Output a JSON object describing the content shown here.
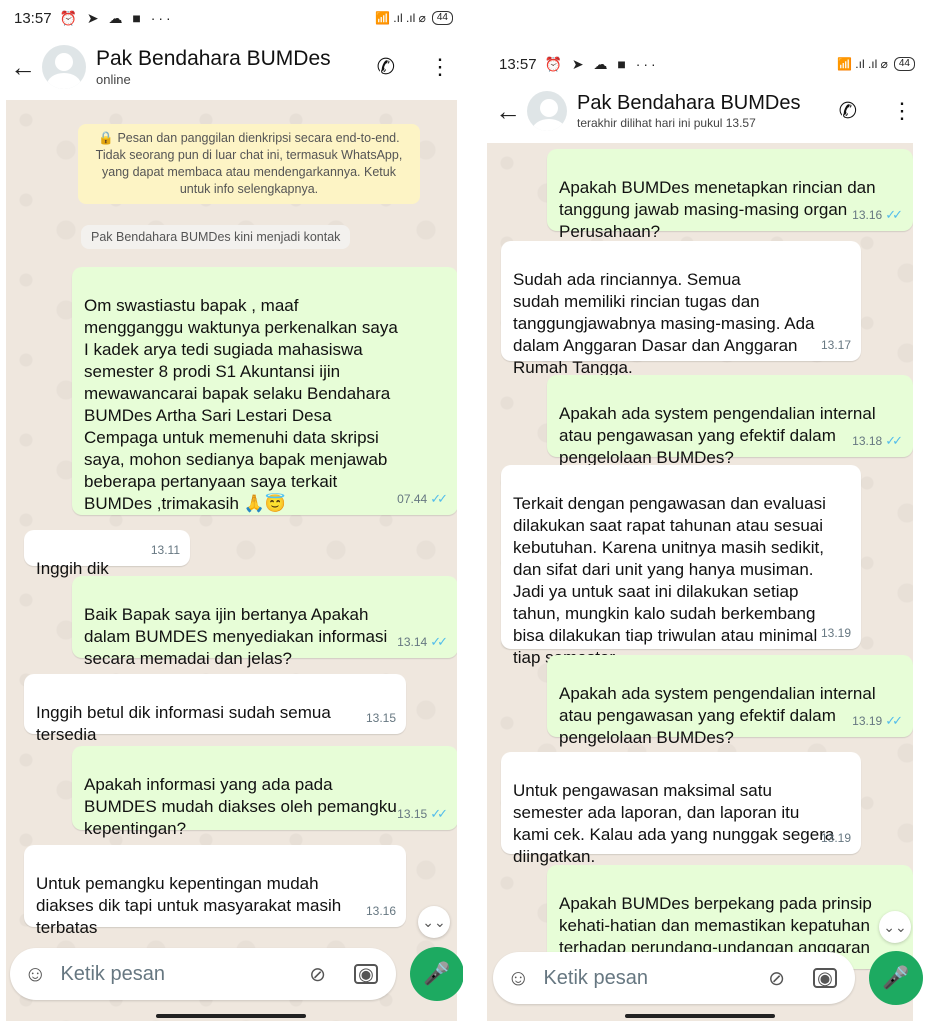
{
  "left": {
    "status": {
      "time": "13:57",
      "icons": "⏰ ➤ ☁ ■ ···",
      "signal": "📶 .ıl .ıl ⌀",
      "battery": "44"
    },
    "header": {
      "name": "Pak Bendahara BUMDes",
      "status": "online"
    },
    "encryption": "🔒 Pesan dan panggilan dienkripsi secara end-to-end. Tidak seorang pun di luar chat ini, termasuk WhatsApp, yang dapat membaca atau mendengarkannya. Ketuk untuk info selengkapnya.",
    "contact_notice": "Pak Bendahara BUMDes kini menjadi kontak",
    "messages": [
      {
        "dir": "out",
        "text": "Om swastiastu bapak , maaf\nmengganggu waktunya perkenalkan saya\nI kadek arya tedi sugiada mahasiswa\nsemester 8 prodi S1 Akuntansi ijin\nmewawancarai bapak selaku Bendahara\nBUMDes Artha Sari Lestari Desa\nCempaga untuk memenuhi data skripsi\nsaya, mohon sedianya bapak menjawab\nbeberapa pertanyaan saya terkait\nBUMDes ,trimakasih 🙏😇",
        "time": "07.44"
      },
      {
        "dir": "in",
        "text": "Inggih dik",
        "time": "13.11"
      },
      {
        "dir": "out",
        "text": "Baik Bapak saya ijin bertanya Apakah\ndalam BUMDES menyediakan informasi\nsecara memadai dan jelas?",
        "time": "13.14"
      },
      {
        "dir": "in",
        "text": "Inggih betul dik informasi sudah semua\ntersedia",
        "time": "13.15"
      },
      {
        "dir": "out",
        "text": "Apakah informasi yang ada pada\nBUMDES mudah diakses oleh pemangku\nkepentingan?",
        "time": "13.15"
      },
      {
        "dir": "in",
        "text": "Untuk pemangku kepentingan mudah\ndiakses dik tapi untuk masyarakat masih\nterbatas",
        "time": "13.16"
      }
    ],
    "composer": {
      "placeholder": "Ketik pesan"
    }
  },
  "right": {
    "status": {
      "time": "13:57",
      "icons": "⏰ ➤ ☁ ■ ···",
      "signal": "📶 .ıl .ıl ⌀",
      "battery": "44"
    },
    "header": {
      "name": "Pak Bendahara BUMDes",
      "status": "terakhir dilihat hari ini pukul 13.57"
    },
    "messages": [
      {
        "dir": "out",
        "text": "Apakah BUMDes menetapkan rincian dan\ntanggung jawab masing-masing organ\nPerusahaan?",
        "time": "13.16"
      },
      {
        "dir": "in",
        "text": "Sudah ada rinciannya. Semua\nsudah memiliki rincian tugas dan\ntanggungjawabnya masing-masing. Ada\ndalam Anggaran Dasar dan Anggaran\nRumah Tangga.",
        "time": "13.17"
      },
      {
        "dir": "out",
        "text": "Apakah ada system pengendalian internal\natau pengawasan yang efektif dalam\npengelolaan BUMDes?",
        "time": "13.18"
      },
      {
        "dir": "in",
        "text": "Terkait dengan pengawasan dan evaluasi\ndilakukan saat rapat tahunan atau sesuai\nkebutuhan. Karena unitnya masih sedikit,\ndan sifat dari unit yang hanya musiman.\nJadi ya untuk saat ini dilakukan setiap\ntahun, mungkin kalo sudah berkembang\nbisa dilakukan tiap triwulan atau minimal\ntiap semester",
        "time": "13.19"
      },
      {
        "dir": "out",
        "text": "Apakah ada system pengendalian internal\natau pengawasan yang efektif dalam\npengelolaan BUMDes?",
        "time": "13.19"
      },
      {
        "dir": "in",
        "text": "Untuk pengawasan maksimal satu\nsemester ada laporan, dan laporan itu\nkami cek. Kalau ada yang nunggak segera\ndiingatkan.",
        "time": "13.19"
      },
      {
        "dir": "out",
        "text": "Apakah BUMDes berpekang pada prinsip\nkehati-hatian dan memastikan kepatuhan\nterhadap perundang-undangan anggaran\ndasar dan peraturan lainnya?",
        "time": ""
      }
    ],
    "composer": {
      "placeholder": "Ketik pesan"
    }
  }
}
